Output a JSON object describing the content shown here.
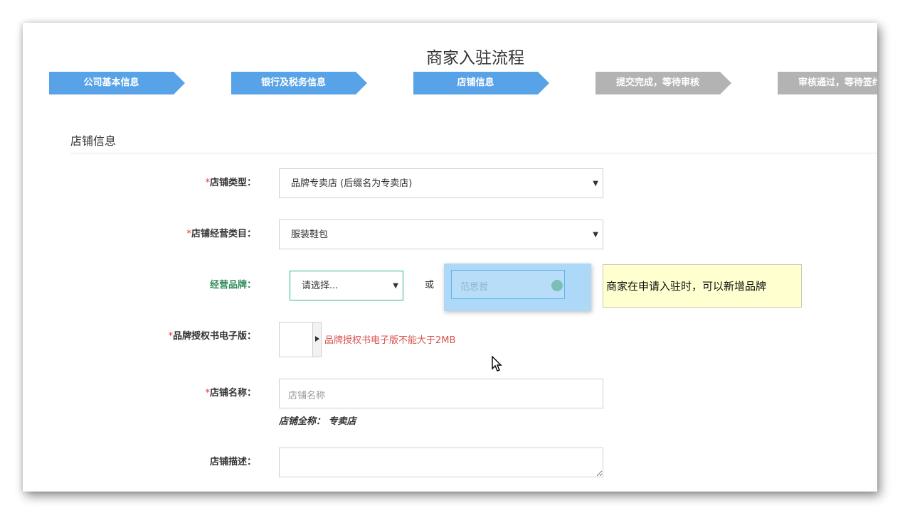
{
  "page_title": "商家入驻流程",
  "steps": [
    {
      "label": "公司基本信息",
      "state": "active"
    },
    {
      "label": "银行及税务信息",
      "state": "active"
    },
    {
      "label": "店铺信息",
      "state": "active"
    },
    {
      "label": "提交完成，等待审核",
      "state": "inactive"
    },
    {
      "label": "审核通过，等待签约",
      "state": "inactive"
    }
  ],
  "section_title": "店铺信息",
  "form": {
    "store_type": {
      "required_mark": "*",
      "label": "店铺类型：",
      "value": "品牌专卖店 (后缀名为专卖店)"
    },
    "store_category": {
      "required_mark": "*",
      "label": "店铺经营类目：",
      "value": "服装鞋包"
    },
    "brand": {
      "label": "经营品牌：",
      "select_placeholder": "请选择...",
      "or_text": "或",
      "new_brand_value": "范思哲"
    },
    "brand_auth": {
      "required_mark": "*",
      "label": "品牌授权书电子版：",
      "error": "品牌授权书电子版不能大于2MB"
    },
    "store_name": {
      "required_mark": "*",
      "label": "店铺名称：",
      "placeholder": "店铺名称",
      "full_name_hint": "店铺全称： 专卖店"
    },
    "store_desc": {
      "label": "店铺描述："
    }
  },
  "tooltip": "商家在申请入驻时，可以新增品牌",
  "colors": {
    "step_active": "#58a3e8",
    "step_inactive": "#b3b3b3",
    "required": "#e33333",
    "error": "#d9534f",
    "brand_label": "#2e8b57",
    "tooltip_bg": "#ffffcf"
  }
}
